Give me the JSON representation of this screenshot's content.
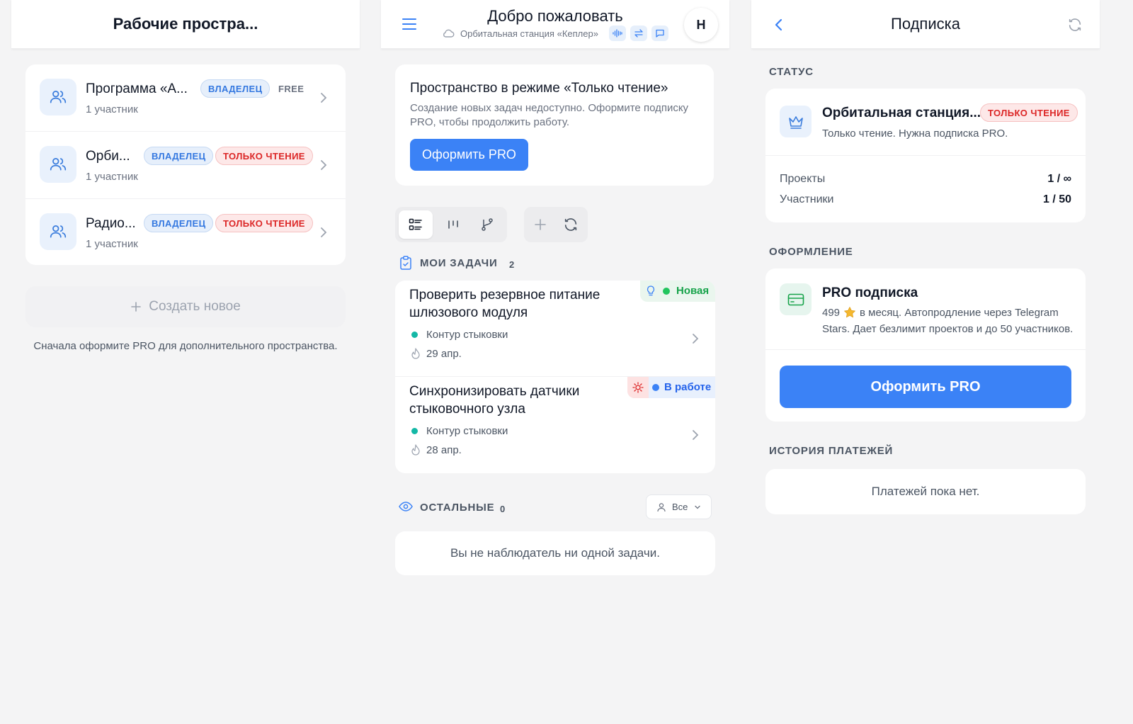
{
  "workspaces": {
    "header_title": "Рабочие простра...",
    "items": [
      {
        "name": "Программа «А...",
        "subtitle": "1 участник",
        "role": "ВЛАДЕЛЕЦ",
        "status": "FREE"
      },
      {
        "name": "Орби...",
        "subtitle": "1 участник",
        "role": "ВЛАДЕЛЕЦ",
        "status": "ТОЛЬКО ЧТЕНИЕ"
      },
      {
        "name": "Радио...",
        "subtitle": "1 участник",
        "role": "ВЛАДЕЛЕЦ",
        "status": "ТОЛЬКО ЧТЕНИЕ"
      }
    ],
    "create_label": "Создать новое",
    "create_hint": "Сначала оформите PRO для дополнительного пространства."
  },
  "home": {
    "header_title": "Добро пожаловать",
    "header_subtitle": "Орбитальная станция «Кеплер»",
    "avatar_letter": "Н",
    "notice_title": "Пространство в режиме «Только чтение»",
    "notice_text": "Создание новых задач недоступно. Оформите подписку PRO, чтобы продолжить работу.",
    "notice_button": "Оформить PRO",
    "my_tasks_label": "МОИ ЗАДАЧИ",
    "my_tasks_count": "2",
    "tasks": [
      {
        "title_line1": "Проверить резервное питание",
        "title_line2": "шлюзового модуля",
        "project": "Контур стыковки",
        "date": "29 апр.",
        "status": "Новая",
        "status_color": "#16a34a"
      },
      {
        "title_line1": "Синхронизировать датчики",
        "title_line2": "стыковочного узла",
        "project": "Контур стыковки",
        "date": "28 апр.",
        "status": "В работе",
        "status_color": "#2563eb"
      }
    ],
    "others_label": "ОСТАЛЬНЫЕ",
    "others_count": "0",
    "filter_label": "Все",
    "others_empty": "Вы не наблюдатель ни одной задачи."
  },
  "subscription": {
    "header_title": "Подписка",
    "status_label": "СТАТУС",
    "space_name": "Орбитальная станция...",
    "space_badge": "ТОЛЬКО ЧТЕНИЕ",
    "space_desc": "Только чтение. Нужна подписка PRO.",
    "projects_label": "Проекты",
    "projects_value": "1 / ∞",
    "members_label": "Участники",
    "members_value": "1 / 50",
    "checkout_label": "ОФОРМЛЕНИЕ",
    "plan_title": "PRO подписка",
    "plan_price": "499",
    "plan_desc_1": "в месяц. Автопродление через Telegram",
    "plan_desc_2": "Stars. Дает безлимит проектов и до 50 участников.",
    "plan_button": "Оформить PRO",
    "history_label": "ИСТОРИЯ ПЛАТЕЖЕЙ",
    "history_empty": "Платежей пока нет."
  },
  "colors": {
    "accent": "#3b82f6",
    "readonly": "#dc2626",
    "owner": "#3478e0",
    "background": "#f4f4f5"
  }
}
